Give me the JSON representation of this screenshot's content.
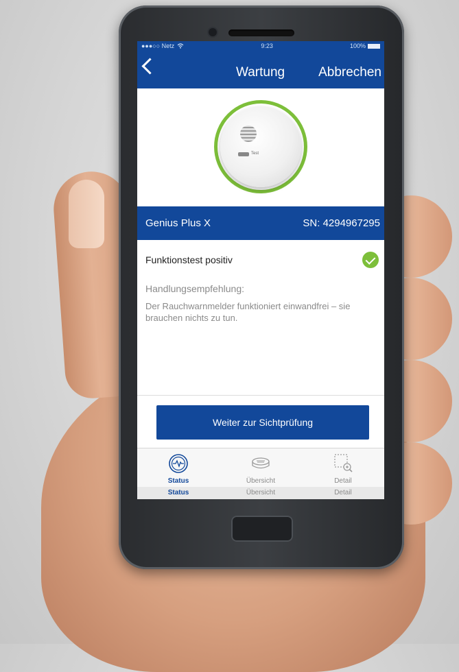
{
  "status_bar": {
    "carrier": "●●●○○ Netz",
    "time": "9:23",
    "battery": "100%"
  },
  "nav": {
    "title": "Wartung",
    "cancel_label": "Abbrechen"
  },
  "device": {
    "test_button_text": "Test",
    "name": "Genius Plus X",
    "serial": "SN: 4294967295"
  },
  "result": {
    "text": "Funktionstest positiv",
    "status_color": "#7dbf3a"
  },
  "recommendation": {
    "title": "Handlungsempfehlung:",
    "body": "Der Rauchwarnmelder funktioniert einwandfrei – sie brauchen nichts zu tun."
  },
  "cta": {
    "label": "Weiter zur Sichtprüfung"
  },
  "tabs": [
    {
      "label": "Status",
      "sublabel": "Status",
      "icon": "status-icon",
      "active": true
    },
    {
      "label": "Übersicht",
      "sublabel": "Übersicht",
      "icon": "detector-icon",
      "active": false
    },
    {
      "label": "Detail",
      "sublabel": "Detail",
      "icon": "zoom-detail-icon",
      "active": false
    }
  ],
  "colors": {
    "brand_blue": "#12489a",
    "success_green": "#7dbf3a"
  }
}
